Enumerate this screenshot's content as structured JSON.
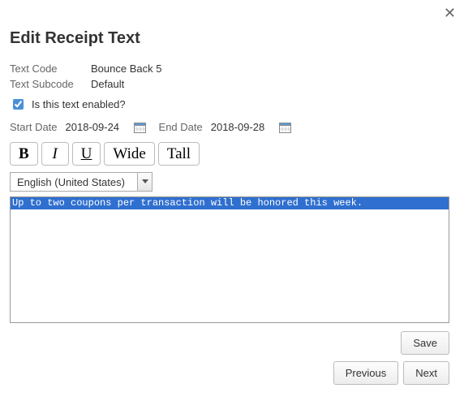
{
  "close_glyph": "✕",
  "title": "Edit Receipt Text",
  "fields": {
    "text_code_label": "Text Code",
    "text_code_value": "Bounce Back 5",
    "text_subcode_label": "Text Subcode",
    "text_subcode_value": "Default"
  },
  "enabled": {
    "checked": true,
    "label": "Is this text enabled?"
  },
  "dates": {
    "start_label": "Start Date",
    "start_value": "2018-09-24",
    "end_label": "End Date",
    "end_value": "2018-09-28"
  },
  "toolbar": {
    "bold": "B",
    "italic": "I",
    "underline": "U",
    "wide": "Wide",
    "tall": "Tall"
  },
  "language": {
    "selected": "English (United States)"
  },
  "editor": {
    "content": "Up to two coupons per transaction will be honored this week."
  },
  "buttons": {
    "save": "Save",
    "previous": "Previous",
    "next": "Next"
  }
}
